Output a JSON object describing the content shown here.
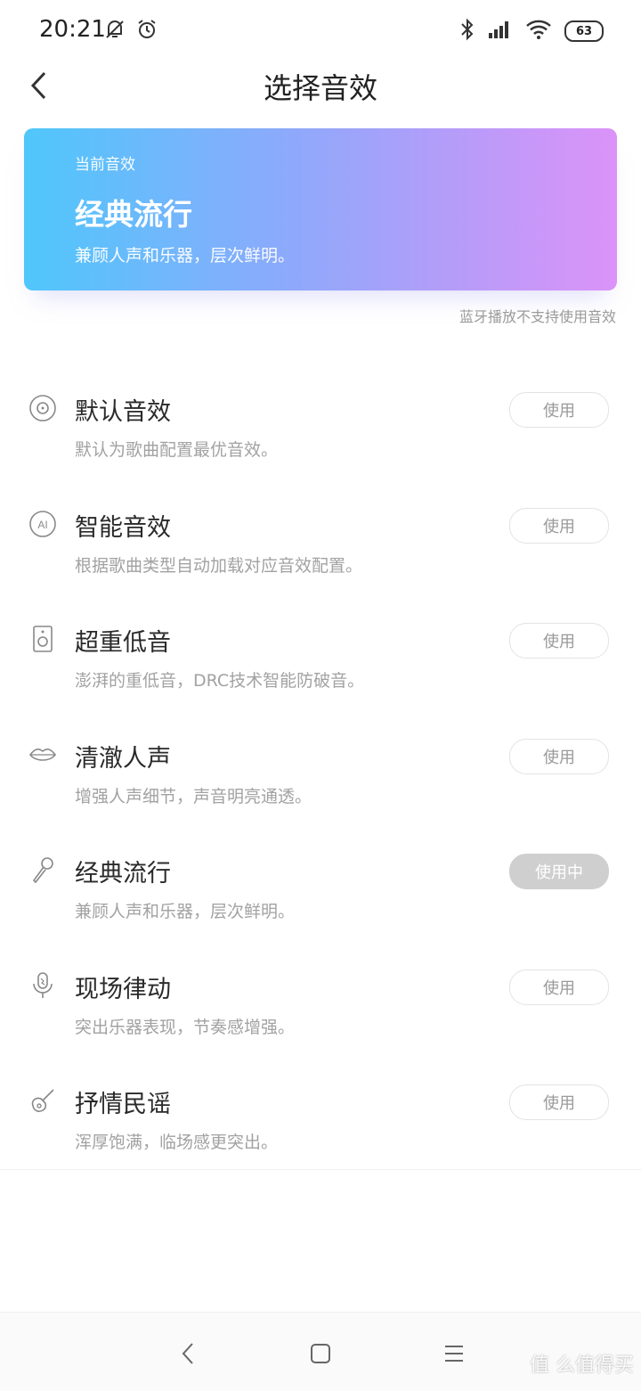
{
  "status_bar": {
    "time": "20:21",
    "left_icons": [
      "muted-bell-icon",
      "alarm-icon"
    ],
    "right_icons": [
      "bluetooth-icon",
      "signal-icon",
      "wifi-icon"
    ],
    "battery": "63"
  },
  "header": {
    "title": "选择音效"
  },
  "current_effect": {
    "caption": "当前音效",
    "name": "经典流行",
    "description": "兼顾人声和乐器，层次鲜明。",
    "gradient": [
      "#4fc7fb",
      "#db93f8"
    ]
  },
  "bluetooth_note": "蓝牙播放不支持使用音效",
  "effects": [
    {
      "icon": "disc-icon",
      "name": "默认音效",
      "description": "默认为歌曲配置最优音效。",
      "button": "使用",
      "active": false
    },
    {
      "icon": "ai-icon",
      "name": "智能音效",
      "description": "根据歌曲类型自动加载对应音效配置。",
      "button": "使用",
      "active": false
    },
    {
      "icon": "speaker-icon",
      "name": "超重低音",
      "description": "澎湃的重低音，DRC技术智能防破音。",
      "button": "使用",
      "active": false
    },
    {
      "icon": "lips-icon",
      "name": "清澈人声",
      "description": "增强人声细节，声音明亮通透。",
      "button": "使用",
      "active": false
    },
    {
      "icon": "microphone-icon",
      "name": "经典流行",
      "description": "兼顾人声和乐器，层次鲜明。",
      "button": "使用中",
      "active": true
    },
    {
      "icon": "live-mic-icon",
      "name": "现场律动",
      "description": "突出乐器表现，节奏感增强。",
      "button": "使用",
      "active": false
    },
    {
      "icon": "guitar-icon",
      "name": "抒情民谣",
      "description": "浑厚饱满，临场感更突出。",
      "button": "使用",
      "active": false
    }
  ],
  "nav_bar": {
    "buttons": [
      "back-icon",
      "home-icon",
      "menu-icon"
    ]
  },
  "watermark": "值 么值得买"
}
